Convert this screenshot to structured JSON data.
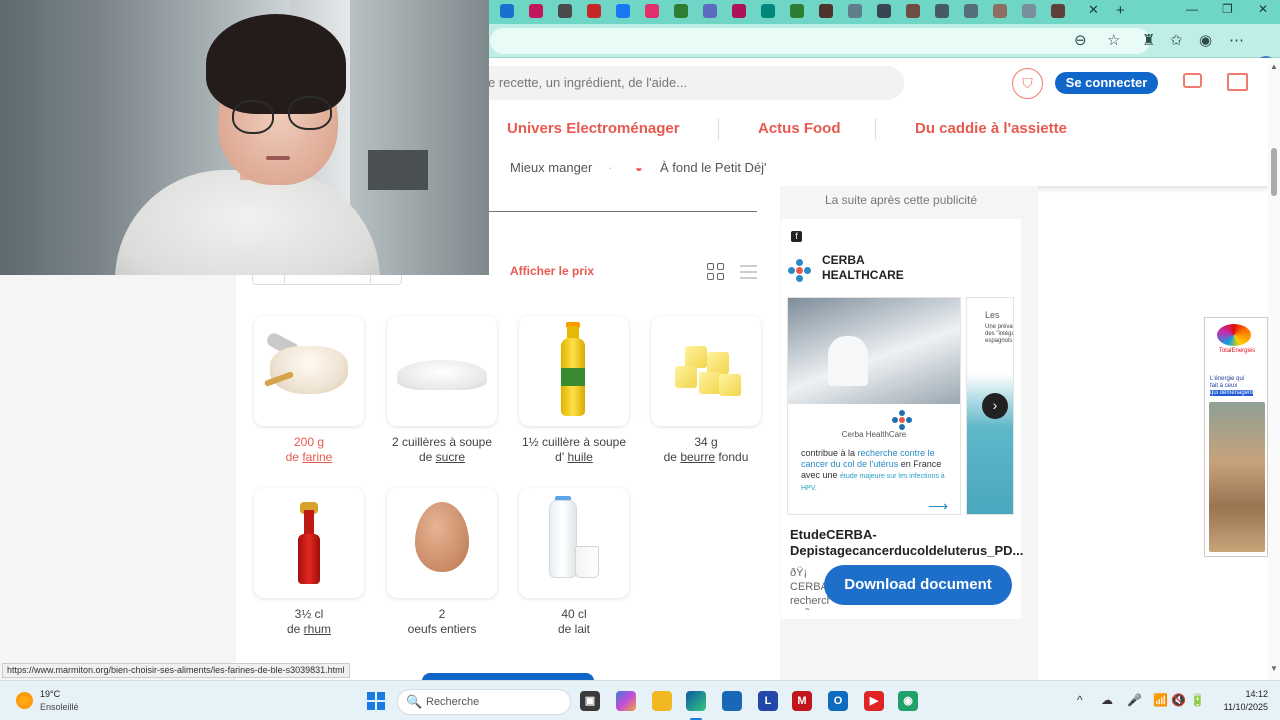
{
  "browser": {
    "tab_close": "✕",
    "new_tab": "+",
    "window_controls": [
      "—",
      "❐",
      "✕"
    ],
    "tab_favicon_colors": [
      "#1b6fd1",
      "#c2185b",
      "#4a4a4a",
      "#c62828",
      "#1877f2",
      "#e1306c",
      "#2e7d32",
      "#5c6bc0",
      "#ad1457",
      "#00897b",
      "#2e7d32",
      "#4e342e",
      "#607d8b",
      "#37474f",
      "#6d4c41",
      "#455a64",
      "#546e7a",
      "#8d6e63",
      "#78909c",
      "#5d4037"
    ]
  },
  "header": {
    "search_placeholder": "e recette, un ingrédient, de l'aide...",
    "login_label": "Se connecter",
    "nav_main": [
      "Univers Electroménager",
      "Actus Food",
      "Du caddie à l'assiette"
    ],
    "nav_sub": [
      "Mieux manger",
      "À fond le Petit Déj'"
    ],
    "nav_dot": "·"
  },
  "ingredients_section": {
    "price_label": "Afficher le prix",
    "items": [
      {
        "quantity": "200 g",
        "prefix": "de",
        "name": "farine",
        "suffix": "",
        "image": "flour",
        "highlight": true
      },
      {
        "quantity": "2 cuillères à soupe",
        "prefix": "de",
        "name": "sucre",
        "suffix": "",
        "image": "sugar",
        "highlight": false
      },
      {
        "quantity": "1½ cuillère à soupe",
        "prefix": "d'",
        "name": "huile",
        "suffix": "",
        "image": "oil",
        "highlight": false
      },
      {
        "quantity": "34 g",
        "prefix": "de",
        "name": "beurre",
        "suffix": "fondu",
        "image": "butter",
        "highlight": false
      },
      {
        "quantity": "3½ cl",
        "prefix": "de",
        "name": "rhum",
        "suffix": "",
        "image": "rum",
        "highlight": false
      },
      {
        "quantity": "2",
        "prefix": "",
        "name": "",
        "suffix": "oeufs entiers",
        "image": "egg",
        "highlight": false
      },
      {
        "quantity": "40 cl",
        "prefix": "de lait",
        "name": "",
        "suffix": "",
        "image": "milk",
        "highlight": false
      }
    ]
  },
  "ad": {
    "note": "La suite après cette publicité",
    "advertiser": "CERBA HEALTHCARE",
    "logo_text": "Cerba HealthCare",
    "desc_1": "contribue à la ",
    "desc_2": "recherche contre le cancer du col de l'utérus",
    "desc_3": " en France avec une ",
    "desc_4": "étude majeure sur les infections à HPV.",
    "side_title": "Les",
    "side_sub": "Une préval des \"intéga espagnols",
    "title": "EtudeCERBA-Depistagecancerducoldeluterus_PD...",
    "body": "ðŸ¡ CERBA recherche l'utÃ©rus",
    "download_label": "Download document",
    "carousel_next": "›"
  },
  "side_ad": {
    "brand": "TotalEnergies",
    "text_1": "L'énergie qui",
    "text_2": "fait à ceux",
    "text_3": "qui déménagent"
  },
  "status_url": "https://www.marmiton.org/bien-choisir-ses-aliments/les-farines-de-ble-s3039831.html",
  "taskbar": {
    "weather_temp": "19°C",
    "weather_desc": "Ensoleillé",
    "search_label": "Recherche",
    "search_icon": "🔍",
    "time": "14:12",
    "date": "11/10/2025",
    "tray_icons": [
      "^",
      "☁",
      "🎤",
      "📶",
      "🔇",
      "🔋"
    ]
  }
}
